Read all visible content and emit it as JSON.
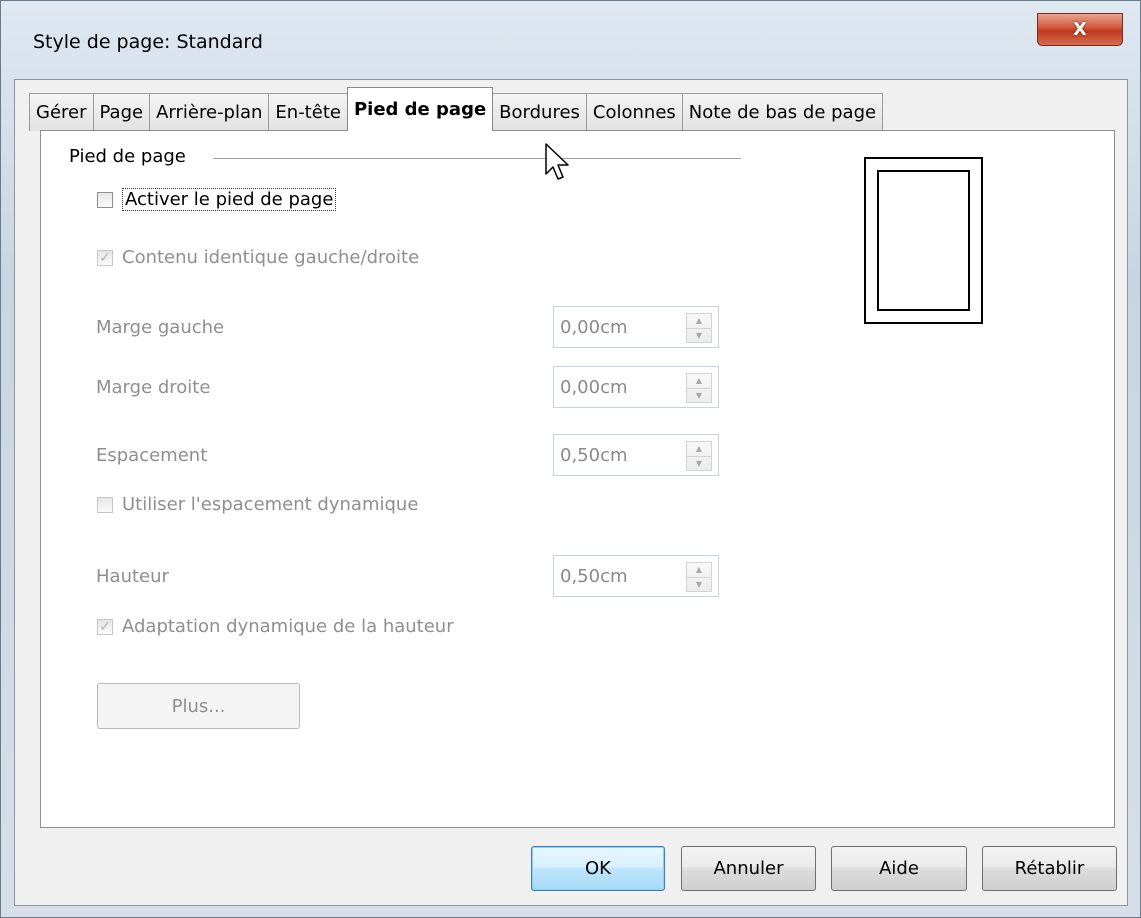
{
  "window": {
    "title": "Style de page: Standard",
    "close_symbol": "X"
  },
  "tabs": [
    {
      "label": "Gérer",
      "active": false
    },
    {
      "label": "Page",
      "active": false
    },
    {
      "label": "Arrière-plan",
      "active": false
    },
    {
      "label": "En-tête",
      "active": false
    },
    {
      "label": "Pied de page",
      "active": true
    },
    {
      "label": "Bordures",
      "active": false
    },
    {
      "label": "Colonnes",
      "active": false
    },
    {
      "label": "Note de bas de page",
      "active": false
    }
  ],
  "footer_section": {
    "group_label": "Pied de page",
    "activate_footer": {
      "label": "Activer le pied de page",
      "checked": false,
      "enabled": true
    },
    "same_content": {
      "label": "Contenu identique gauche/droite",
      "checked": true,
      "enabled": false
    },
    "left_margin": {
      "label": "Marge gauche",
      "value": "0,00cm"
    },
    "right_margin": {
      "label": "Marge droite",
      "value": "0,00cm"
    },
    "spacing": {
      "label": "Espacement",
      "value": "0,50cm"
    },
    "dynamic_spacing": {
      "label": "Utiliser l'espacement dynamique",
      "checked": false,
      "enabled": false
    },
    "height": {
      "label": "Hauteur",
      "value": "0,50cm"
    },
    "autofit_height": {
      "label": "Adaptation dynamique de la hauteur",
      "checked": true,
      "enabled": false
    },
    "more_button": "Plus..."
  },
  "buttons": {
    "ok": "OK",
    "cancel": "Annuler",
    "help": "Aide",
    "reset": "Rétablir"
  },
  "icons": {
    "check_glyph": "✓",
    "spin_up": "▲",
    "spin_down": "▼"
  }
}
